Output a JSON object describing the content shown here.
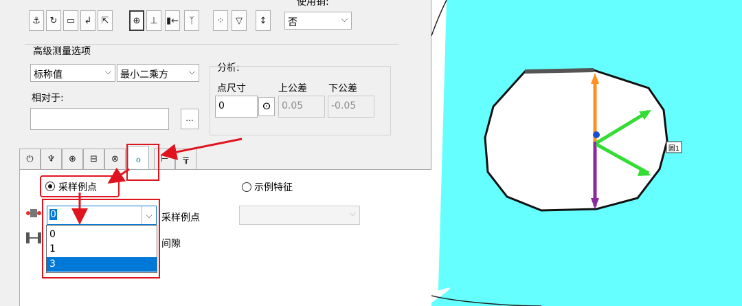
{
  "toolbar": {
    "use_pin_label": "使用销:",
    "use_pin_value": "否",
    "icons": [
      "anchor-icon",
      "rotate-icon",
      "page-icon",
      "return-arrow-icon",
      "move-icon",
      "target-icon",
      "point-down-icon",
      "align-left-icon",
      "align-v-icon",
      "points-icon",
      "filter-icon",
      "vertical-arrows-icon"
    ]
  },
  "advanced": {
    "group_title": "高级测量选项",
    "nominal_combo": "标称值",
    "method_combo": "最小二乘方",
    "relative_to_label": "相对于:",
    "browse_label": "..."
  },
  "analysis": {
    "title": "分析:",
    "point_size_label": "点尺寸",
    "upper_tol_label": "上公差",
    "lower_tol_label": "下公差",
    "point_size_value": "0",
    "upper_tol_value": "0.05",
    "lower_tol_value": "-0.05"
  },
  "tabs": [
    "power-icon",
    "fork-icon",
    "crosshair-icon",
    "card-icon",
    "cross-circle-icon",
    "sample-icon",
    "wrench-icon",
    "pin-icon"
  ],
  "sample": {
    "radio_sample_points": "采样例点",
    "radio_example_feature": "示例特征",
    "count_value": "0",
    "count_label": "采样例点",
    "gap_label": "间隙",
    "options": [
      "0",
      "1",
      "3"
    ],
    "selected_option": "3"
  },
  "viewport": {
    "label_tag": "圆1"
  },
  "colors": {
    "cyan": "#66ffff",
    "highlight": "#0078d7",
    "annotation_red": "#e0141e"
  }
}
